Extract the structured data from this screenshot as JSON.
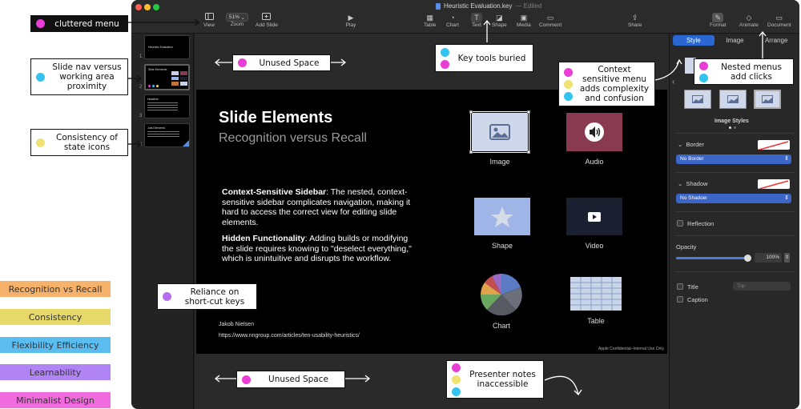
{
  "app": {
    "window_title": "Heuristic Evaluation.key",
    "window_status": "Edited"
  },
  "toolbar": {
    "view": "View",
    "zoom_value": "51%",
    "zoom": "Zoom",
    "add_slide": "Add Slide",
    "play": "Play",
    "table": "Table",
    "chart": "Chart",
    "text": "Text",
    "shape": "Shape",
    "media": "Media",
    "comment": "Comment",
    "share": "Share",
    "format": "Format",
    "animate": "Animate",
    "document": "Document"
  },
  "navigator": {
    "slide_numbers": [
      "1",
      "2",
      "3",
      "4"
    ],
    "thumb_titles": [
      "Heuristic Evaluation",
      "Slide Elements",
      "Headline",
      "Just Elements"
    ]
  },
  "slide": {
    "title": "Slide Elements",
    "subtitle": "Recognition versus Recall",
    "p1_bold": "Context-Sensitive Sidebar",
    "p1_text": ": The nested, context-sensitive sidebar complicates navigation, making it hard to access the correct view for editing slide elements.",
    "p2_bold": "Hidden Functionality",
    "p2_text": ": Adding builds or modifying the slide requires knowing to \"deselect everything,\" which is unintuitive and disrupts the workflow.",
    "author": "Jakob Nielsen",
    "url": "https://www.nngroup.com/articles/ten-usability-heuristics/",
    "confidential": "Apple Confidential–Internal Use Only",
    "elements": {
      "image": "Image",
      "audio": "Audio",
      "shape": "Shape",
      "video": "Video",
      "chart": "Chart",
      "table": "Table"
    }
  },
  "inspector": {
    "tabs": [
      "Style",
      "Image",
      "Arrange"
    ],
    "image_styles": "Image Styles",
    "border": "Border",
    "border_value": "No Border",
    "shadow": "Shadow",
    "shadow_value": "No Shadow",
    "reflection": "Reflection",
    "opacity": "Opacity",
    "opacity_value": "100%",
    "opacity_level": 1.0,
    "title": "Title",
    "title_position": "Top",
    "caption": "Caption"
  },
  "annotations": {
    "cluttered_menu": "cluttered menu",
    "slide_nav": "Slide nav versus working area proximity",
    "state_icons": "Consistency of state icons",
    "unused_space_top": "Unused Space",
    "key_tools": "Key tools buried",
    "context_menu": "Context sensitive menu adds complexity and confusion",
    "nested_menus": "Nested menus add clicks",
    "shortcut_keys": "Reliance on short-cut keys",
    "unused_space_bottom": "Unused Space",
    "presenter_notes": "Presenter notes inaccessible"
  },
  "legend": [
    {
      "label": "Recognition vs Recall",
      "color": "#f6b26b"
    },
    {
      "label": "Consistency",
      "color": "#e6d96a"
    },
    {
      "label": "Flexibility Efficiency",
      "color": "#5bbcf0"
    },
    {
      "label": "Learnability",
      "color": "#b084f5"
    },
    {
      "label": "Minimalist Design",
      "color": "#f06bde"
    }
  ],
  "colors": {
    "pink": "#e83ed6",
    "cyan": "#33c3f0",
    "yellow": "#efe271",
    "purple": "#b56cf2",
    "accent_blue": "#2b67d3"
  }
}
